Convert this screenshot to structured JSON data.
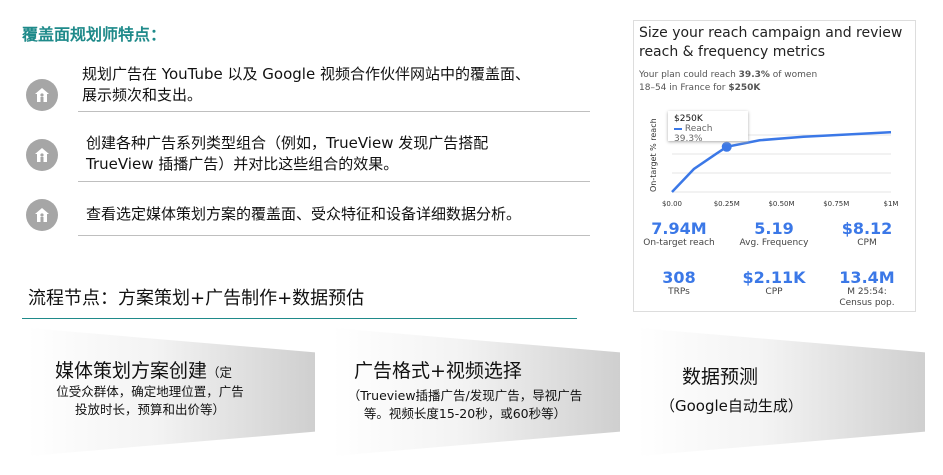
{
  "title": "覆盖面规划师特点：",
  "features": [
    {
      "icon": "home-user-icon",
      "lines": [
        "规划广告在 YouTube 以及 Google 视频合作伙伴网站中的覆盖面、",
        "展示频次和支出。"
      ]
    },
    {
      "icon": "home-user-icon",
      "lines": [
        "创建各种广告系列类型组合（例如，TrueView 发现广告搭配",
        "TrueView 插播广告）并对比这些组合的效果。"
      ]
    },
    {
      "icon": "home-user-icon",
      "lines": [
        "查看选定媒体策划方案的覆盖面、受众特征和设备详细数据分析。"
      ]
    }
  ],
  "flow_title": "流程节点：方案策划+广告制作+数据预估",
  "steps": [
    {
      "title": "媒体策划方案创建",
      "note_inline": "（定",
      "sub": "位受众群体，确定地理位置，广告投放时长，预算和出价等）"
    },
    {
      "title": "广告格式+视频选择",
      "sub": "（Trueview插播广告/发现广告，导视广告等。视频长度15-20秒，或60秒等）"
    },
    {
      "title": "数据预测",
      "sub": "（Google自动生成）"
    }
  ],
  "card": {
    "heading": "Size your reach campaign and review reach & frequency metrics",
    "desc_pre": "Your plan could reach ",
    "desc_pct": "39.3%",
    "desc_mid": " of women 18–54 in France for ",
    "desc_amt": "$250K",
    "tooltip_title": "$250K",
    "tooltip_series": "Reach 39.3%",
    "stats": [
      {
        "value": "7.94M",
        "label": "On-target reach"
      },
      {
        "value": "5.19",
        "label": "Avg. Frequency"
      },
      {
        "value": "$8.12",
        "label": "CPM"
      },
      {
        "value": "308",
        "label": "TRPs"
      },
      {
        "value": "$2.11K",
        "label": "CPP"
      },
      {
        "value": "13.4M",
        "label": "M 25:54: Census pop."
      }
    ],
    "accent": "#3b78e7"
  },
  "chart_data": {
    "type": "line",
    "ylabel": "On-target % reach",
    "x_ticks": [
      "$0.00",
      "$0.25M",
      "$0.50M",
      "$0.75M",
      "$1M"
    ],
    "x": [
      0,
      0.1,
      0.2,
      0.25,
      0.4,
      0.6,
      0.8,
      1.0
    ],
    "y": [
      0,
      20,
      33,
      39.3,
      45,
      48,
      50,
      52
    ],
    "xlim": [
      0,
      1
    ],
    "ylim": [
      0,
      60
    ],
    "highlight": {
      "x": 0.25,
      "y": 39.3,
      "label": "$250K"
    },
    "series_name": "Reach"
  }
}
